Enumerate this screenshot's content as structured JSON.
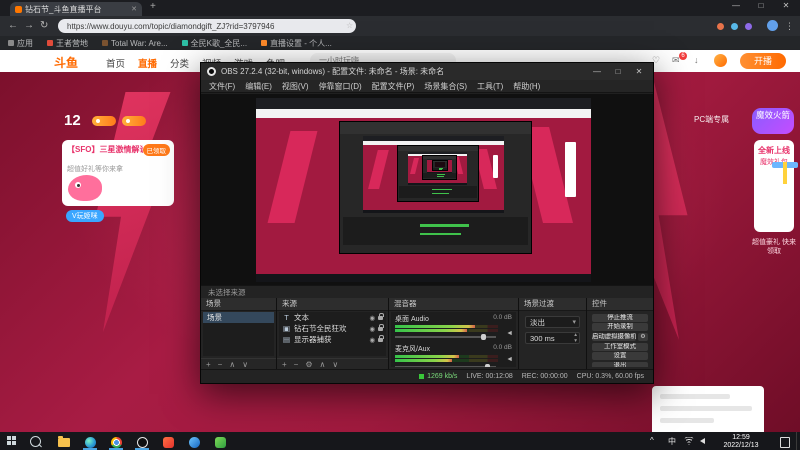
{
  "glyphs": {
    "back": "←",
    "forward": "→",
    "reload": "↻",
    "menu": "⋮",
    "star": "☆",
    "plus": "+",
    "minus": "−",
    "up": "∧",
    "down": "∨",
    "gear": "⚙",
    "caret": "▾",
    "close": "✕",
    "min": "—",
    "max": "□",
    "newtab": "+",
    "eye": "◉",
    "spk": "◄",
    "tray_up": "^",
    "spin_up": "▴",
    "spin_down": "▾",
    "heart": "♡",
    "mail": "✉",
    "download": "↓"
  },
  "browser": {
    "tab_title": "钻石节_斗鱼直播平台",
    "url": "https://www.douyu.com/topic/diamondgift_ZJ?rid=3797946",
    "bookmarks": [
      "应用",
      "王者营地",
      "Total War: Are...",
      "全民K歌_全民...",
      "直播设置 - 个人..."
    ]
  },
  "douyu": {
    "logo": "斗鱼",
    "nav": [
      "首页",
      "直播",
      "分类",
      "视频",
      "游戏",
      "鱼吧"
    ],
    "search_placeholder": "一小时玩嗨",
    "msg_badge": "6",
    "live_button": "开播",
    "left": {
      "stat": "12",
      "card_title": "【SFO】三星激情解说",
      "card_tag": "已领取",
      "card_sub": "超值好礼等你来拿",
      "mascot_badge": "V玩姬咪"
    },
    "right": {
      "pc_label": "PC端专属",
      "bubble": "魔效火箭",
      "promo_title": "全新上线",
      "promo_sub": "魔效礼包",
      "caption": "超值豪礼 快来领取"
    }
  },
  "obs": {
    "title": "OBS 27.2.4 (32-bit, windows) - 配置文件: 未命名 - 场景: 未命名",
    "menu": [
      "文件(F)",
      "编辑(E)",
      "视图(V)",
      "停靠窗口(D)",
      "配置文件(P)",
      "场景集合(S)",
      "工具(T)",
      "帮助(H)"
    ],
    "no_source": "未选择来源",
    "scenes": {
      "title": "场景",
      "items": [
        "场景"
      ]
    },
    "sources": {
      "title": "来源",
      "items": [
        {
          "icon": "T",
          "name": "文本"
        },
        {
          "icon": "▣",
          "name": "钻石节全民狂欢"
        },
        {
          "icon": "▤",
          "name": "显示器捕获"
        }
      ]
    },
    "mixer": {
      "title": "混音器",
      "channels": [
        {
          "name": "桌面 Audio",
          "db": "0.0 dB",
          "level": 78
        },
        {
          "name": "麦克风/Aux",
          "db": "0.0 dB",
          "level": 62
        }
      ]
    },
    "transitions": {
      "title": "场景过渡",
      "selected": "淡出",
      "duration": "300 ms"
    },
    "controls": {
      "title": "控件",
      "buttons": [
        "停止推流",
        "开始录制",
        "启动虚拟摄像机",
        "工作室模式",
        "设置",
        "退出"
      ]
    },
    "status": {
      "bitrate": "1269 kb/s",
      "live": "LIVE: 00:12:08",
      "rec": "REC: 00:00:00",
      "cpu": "CPU: 0.3%, 60.00 fps"
    }
  },
  "taskbar": {
    "time": "12:59",
    "date": "2022/12/13",
    "ime": "中"
  }
}
